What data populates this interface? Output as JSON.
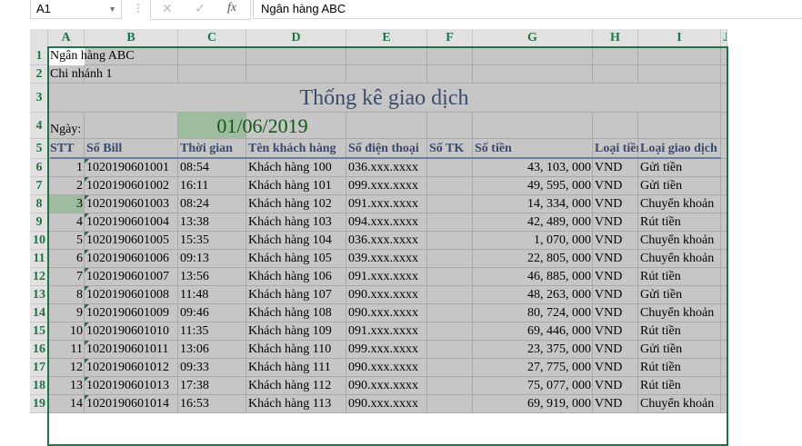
{
  "formula_bar": {
    "name_box": "A1",
    "cancel_icon": "✕",
    "enter_icon": "✓",
    "fx_label": "fx",
    "formula": "Ngân hàng ABC"
  },
  "columns": [
    "A",
    "B",
    "C",
    "D",
    "E",
    "F",
    "G",
    "H",
    "I",
    "J"
  ],
  "rows_header": [
    "1",
    "2",
    "3",
    "4",
    "5",
    "6",
    "7",
    "8",
    "9",
    "10",
    "11",
    "12",
    "13",
    "14",
    "15",
    "16",
    "17",
    "18",
    "19"
  ],
  "sheet": {
    "bank": "Ngân hàng ABC",
    "branch": "Chi nhánh 1",
    "title": "Thống kê giao dịch",
    "date_label": "Ngày:",
    "date": "01/06/2019",
    "accent": "#217346",
    "date_fill": "#9dbd9e"
  },
  "headers": [
    "STT",
    "Số Bill",
    "Thời gian",
    "Tên khách hàng",
    "Số điện thoại",
    "Số TK",
    "Số tiền",
    "Loại tiền",
    "Loại giao dịch"
  ],
  "data": [
    [
      "1",
      "1020190601001",
      "08:54",
      "Khách hàng 100",
      "036.xxx.xxxx",
      "",
      "43, 103, 000",
      "VND",
      "Gửi tiền"
    ],
    [
      "2",
      "1020190601002",
      "16:11",
      "Khách hàng 101",
      "099.xxx.xxxx",
      "",
      "49, 595, 000",
      "VND",
      "Gửi tiền"
    ],
    [
      "3",
      "1020190601003",
      "08:24",
      "Khách hàng 102",
      "091.xxx.xxxx",
      "",
      "14, 334, 000",
      "VND",
      "Chuyển khoản"
    ],
    [
      "4",
      "1020190601004",
      "13:38",
      "Khách hàng 103",
      "094.xxx.xxxx",
      "",
      "42, 489, 000",
      "VND",
      "Rút tiền"
    ],
    [
      "5",
      "1020190601005",
      "15:35",
      "Khách hàng 104",
      "036.xxx.xxxx",
      "",
      "1, 070, 000",
      "VND",
      "Chuyển khoản"
    ],
    [
      "6",
      "1020190601006",
      "09:13",
      "Khách hàng 105",
      "039.xxx.xxxx",
      "",
      "22, 805, 000",
      "VND",
      "Chuyển khoản"
    ],
    [
      "7",
      "1020190601007",
      "13:56",
      "Khách hàng 106",
      "091.xxx.xxxx",
      "",
      "46, 885, 000",
      "VND",
      "Rút tiền"
    ],
    [
      "8",
      "1020190601008",
      "11:48",
      "Khách hàng 107",
      "090.xxx.xxxx",
      "",
      "48, 263, 000",
      "VND",
      "Gửi tiền"
    ],
    [
      "9",
      "1020190601009",
      "09:46",
      "Khách hàng 108",
      "090.xxx.xxxx",
      "",
      "80, 724, 000",
      "VND",
      "Chuyển khoản"
    ],
    [
      "10",
      "1020190601010",
      "11:35",
      "Khách hàng 109",
      "091.xxx.xxxx",
      "",
      "69, 446, 000",
      "VND",
      "Rút tiền"
    ],
    [
      "11",
      "1020190601011",
      "13:06",
      "Khách hàng 110",
      "099.xxx.xxxx",
      "",
      "23, 375, 000",
      "VND",
      "Gửi tiền"
    ],
    [
      "12",
      "1020190601012",
      "09:33",
      "Khách hàng 111",
      "090.xxx.xxxx",
      "",
      "27, 775, 000",
      "VND",
      "Rút tiền"
    ],
    [
      "13",
      "1020190601013",
      "17:38",
      "Khách hàng 112",
      "090.xxx.xxxx",
      "",
      "75, 077, 000",
      "VND",
      "Rút tiền"
    ],
    [
      "14",
      "1020190601014",
      "16:53",
      "Khách hàng 113",
      "090.xxx.xxxx",
      "",
      "69, 919, 000",
      "VND",
      "Chuyển khoản"
    ]
  ]
}
